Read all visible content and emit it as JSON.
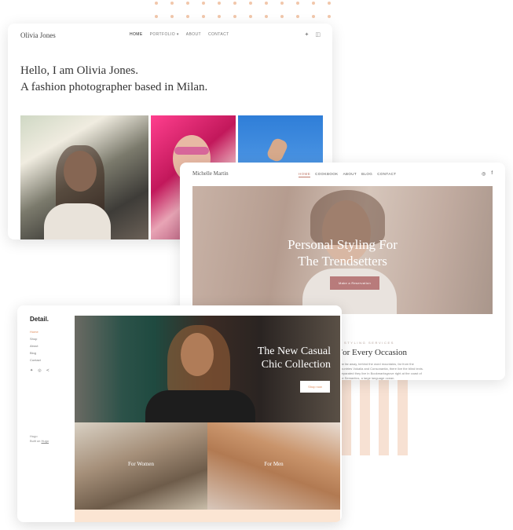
{
  "card1": {
    "brand": "Olivia Jones",
    "nav": [
      "HOME",
      "PORTFOLIO",
      "ABOUT",
      "CONTACT"
    ],
    "icons": [
      "twitter-icon",
      "instagram-icon"
    ],
    "hero_line1": "Hello, I am Olivia Jones.",
    "hero_line2": "A fashion photographer based in Milan."
  },
  "card2": {
    "brand": "Michelle Martin",
    "nav": [
      "HOME",
      "COOKBOOK",
      "ABOUT",
      "BLOG",
      "CONTACT"
    ],
    "icons": [
      "instagram-icon",
      "facebook-icon"
    ],
    "hero_line1": "Personal Styling For",
    "hero_line2": "The Trendsetters",
    "cta": "Make a Reservation",
    "section_label": "STYLING SERVICES",
    "section_title": "For Every Occasion",
    "section_text": "Far far away, behind the word mountains, far from the countries Vokalia and Consonantia, there live the blind texts. Separated they live in Bookmarksgrove right at the coast of the Semantics, a large language ocean."
  },
  "card3": {
    "brand": "Detail.",
    "menu": [
      "Home",
      "Shop",
      "About",
      "Blog",
      "Contact"
    ],
    "icons": [
      "twitter-icon",
      "instagram-icon",
      "share-icon"
    ],
    "footer_line1": "Hugo",
    "footer_line2_prefix": "Built on",
    "footer_link": "Hugo",
    "hero_line1": "The New Casual",
    "hero_line2": "Chic Collection",
    "cta": "Shop now",
    "women": "For Women",
    "men": "For Men"
  },
  "colors": {
    "accent_orange": "#e08c5b",
    "accent_rose": "#b87b7b",
    "decor_peach": "#f7e1d3"
  }
}
